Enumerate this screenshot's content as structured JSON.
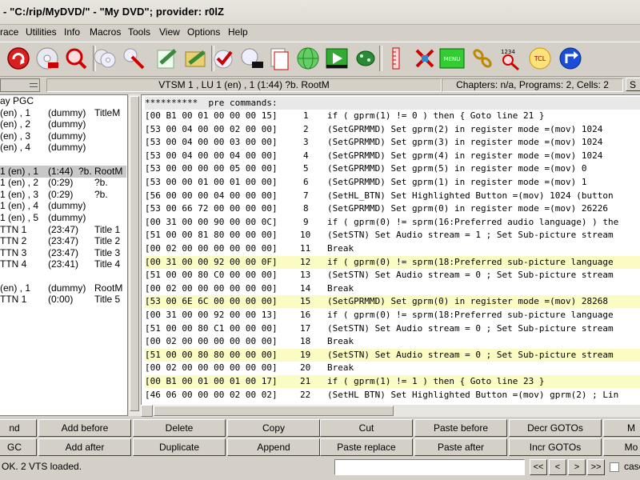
{
  "window": {
    "title": "-  \"C:/rip/MyDVD/\" - \"My DVD\"; provider: r0lZ"
  },
  "menu": [
    "race",
    "Utilities",
    "Info",
    "Macros",
    "Tools",
    "View",
    "Options",
    "Help"
  ],
  "toolbar_icons": [
    "red-circle-arrow-icon",
    "disc-icon",
    "magnifier-icon",
    "discs-icon",
    "wand-icon",
    "green-arrow-icon",
    "folder-icon",
    "check-icon",
    "disc-add-icon",
    "document-icon",
    "globe-icon",
    "play-icon",
    "dragon-icon",
    "ruler-icon",
    "cross-icon",
    "menu-icon",
    "chain-icon",
    "tcl-magnifier-icon",
    "tcl-icon",
    "blue-arrow-icon"
  ],
  "toolbar_menu_label": "MENU",
  "toolbar_tcl_label": "TCL",
  "toolbar_1234_label": "1234",
  "infobar": {
    "vtsm": "VTSM 1 , LU 1 (en) , 1 (1:44) ?b.  RootM",
    "chapters": "Chapters: n/a,  Programs: 2,  Cells: 2",
    "s_button": "S"
  },
  "tree": [
    {
      "a": "ay PGC",
      "b": "",
      "c": ""
    },
    {
      "a": "(en) , 1",
      "b": "(dummy)",
      "c": "TitleM"
    },
    {
      "a": "(en) , 2",
      "b": "(dummy)",
      "c": ""
    },
    {
      "a": "(en) , 3",
      "b": "(dummy)",
      "c": ""
    },
    {
      "a": "(en) , 4",
      "b": "(dummy)",
      "c": ""
    },
    {
      "a": "",
      "b": "",
      "c": ""
    },
    {
      "a": "1 (en) , 1",
      "b": "(1:44)",
      "c": "?b.    RootM",
      "sel": true
    },
    {
      "a": "1 (en) , 2",
      "b": "(0:29)",
      "c": "?b.",
      "sel": false
    },
    {
      "a": "1 (en) , 3",
      "b": "(0:29)",
      "c": "?b."
    },
    {
      "a": "1 (en) , 4",
      "b": "(dummy)",
      "c": ""
    },
    {
      "a": "1 (en) , 5",
      "b": "(dummy)",
      "c": ""
    },
    {
      "a": "  TTN 1",
      "b": "(23:47)",
      "c": "Title 1"
    },
    {
      "a": "  TTN 2",
      "b": "(23:47)",
      "c": "Title 2"
    },
    {
      "a": "  TTN 3",
      "b": "(23:47)",
      "c": "Title 3"
    },
    {
      "a": "  TTN 4",
      "b": "(23:41)",
      "c": "Title 4"
    },
    {
      "a": "",
      "b": "",
      "c": ""
    },
    {
      "a": "(en) , 1",
      "b": "(dummy)",
      "c": "RootM"
    },
    {
      "a": "  TTN 1",
      "b": "(0:00)",
      "c": "Title 5"
    }
  ],
  "code_header": "**********  pre commands:",
  "code": [
    {
      "hex": "[00 B1 00 01 00 00 00 15]",
      "n": "1",
      "cmd": "if ( gprm(1) != 0 ) then { Goto line 21 }",
      "hl": false
    },
    {
      "hex": "[53 00 04 00 00 02 00 00]",
      "n": "2",
      "cmd": "(SetGPRMMD) Set gprm(2) in register mode =(mov) 1024",
      "hl": false
    },
    {
      "hex": "[53 00 04 00 00 03 00 00]",
      "n": "3",
      "cmd": "(SetGPRMMD) Set gprm(3) in register mode =(mov) 1024",
      "hl": false
    },
    {
      "hex": "[53 00 04 00 00 04 00 00]",
      "n": "4",
      "cmd": "(SetGPRMMD) Set gprm(4) in register mode =(mov) 1024",
      "hl": false
    },
    {
      "hex": "[53 00 00 00 00 05 00 00]",
      "n": "5",
      "cmd": "(SetGPRMMD) Set gprm(5) in register mode =(mov) 0",
      "hl": false
    },
    {
      "hex": "[53 00 00 01 00 01 00 00]",
      "n": "6",
      "cmd": "(SetGPRMMD) Set gprm(1) in register mode =(mov) 1",
      "hl": false
    },
    {
      "hex": "[56 00 00 00 04 00 00 00]",
      "n": "7",
      "cmd": "(SetHL_BTN) Set Highlighted Button =(mov) 1024 (button",
      "hl": false
    },
    {
      "hex": "[53 00 66 72 00 00 00 00]",
      "n": "8",
      "cmd": "(SetGPRMMD) Set gprm(0) in register mode =(mov) 26226",
      "hl": false
    },
    {
      "hex": "[00 31 00 00 90 00 00 0C]",
      "n": "9",
      "cmd": "if ( gprm(0) != sprm(16:Preferred audio language) ) the",
      "hl": false
    },
    {
      "hex": "[51 00 00 81 80 00 00 00]",
      "n": "10",
      "cmd": "(SetSTN) Set Audio stream = 1 ; Set Sub-picture stream",
      "hl": false
    },
    {
      "hex": "[00 02 00 00 00 00 00 00]",
      "n": "11",
      "cmd": "Break",
      "hl": false
    },
    {
      "hex": "[00 31 00 00 92 00 00 0F]",
      "n": "12",
      "cmd": "if ( gprm(0) != sprm(18:Preferred sub-picture language",
      "hl": true
    },
    {
      "hex": "[51 00 00 80 C0 00 00 00]",
      "n": "13",
      "cmd": "(SetSTN) Set Audio stream = 0 ; Set Sub-picture stream",
      "hl": false
    },
    {
      "hex": "[00 02 00 00 00 00 00 00]",
      "n": "14",
      "cmd": "Break",
      "hl": false
    },
    {
      "hex": "[53 00 6E 6C 00 00 00 00]",
      "n": "15",
      "cmd": "(SetGPRMMD) Set gprm(0) in register mode =(mov) 28268",
      "hl": true
    },
    {
      "hex": "[00 31 00 00 92 00 00 13]",
      "n": "16",
      "cmd": "if ( gprm(0) != sprm(18:Preferred sub-picture language",
      "hl": false
    },
    {
      "hex": "[51 00 00 80 C1 00 00 00]",
      "n": "17",
      "cmd": "(SetSTN) Set Audio stream = 0 ; Set Sub-picture stream",
      "hl": false
    },
    {
      "hex": "[00 02 00 00 00 00 00 00]",
      "n": "18",
      "cmd": "Break",
      "hl": false
    },
    {
      "hex": "[51 00 00 80 80 00 00 00]",
      "n": "19",
      "cmd": "(SetSTN) Set Audio stream = 0 ; Set Sub-picture stream",
      "hl": true
    },
    {
      "hex": "[00 02 00 00 00 00 00 00]",
      "n": "20",
      "cmd": "Break",
      "hl": false
    },
    {
      "hex": "[00 B1 00 01 00 01 00 17]",
      "n": "21",
      "cmd": "if ( gprm(1) != 1 ) then { Goto line 23 }",
      "hl": true
    },
    {
      "hex": "[46 06 00 00 00 02 00 02]",
      "n": "22",
      "cmd": "(SetHL BTN) Set Highlighted Button =(mov) gprm(2) ; Lin",
      "hl": false
    }
  ],
  "buttons_row1": [
    "nd",
    "Add before",
    "Delete",
    "Copy",
    "Cut",
    "Paste before",
    "Decr GOTOs",
    "M"
  ],
  "buttons_row2": [
    "GC",
    "Add after",
    "Duplicate",
    "Append",
    "Paste replace",
    "Paste after",
    "Incr GOTOs",
    "Mo"
  ],
  "status": {
    "text": "OK.    2 VTS loaded.",
    "nav": [
      "<<",
      "<",
      ">",
      ">>"
    ],
    "checkbox_label": "case"
  }
}
